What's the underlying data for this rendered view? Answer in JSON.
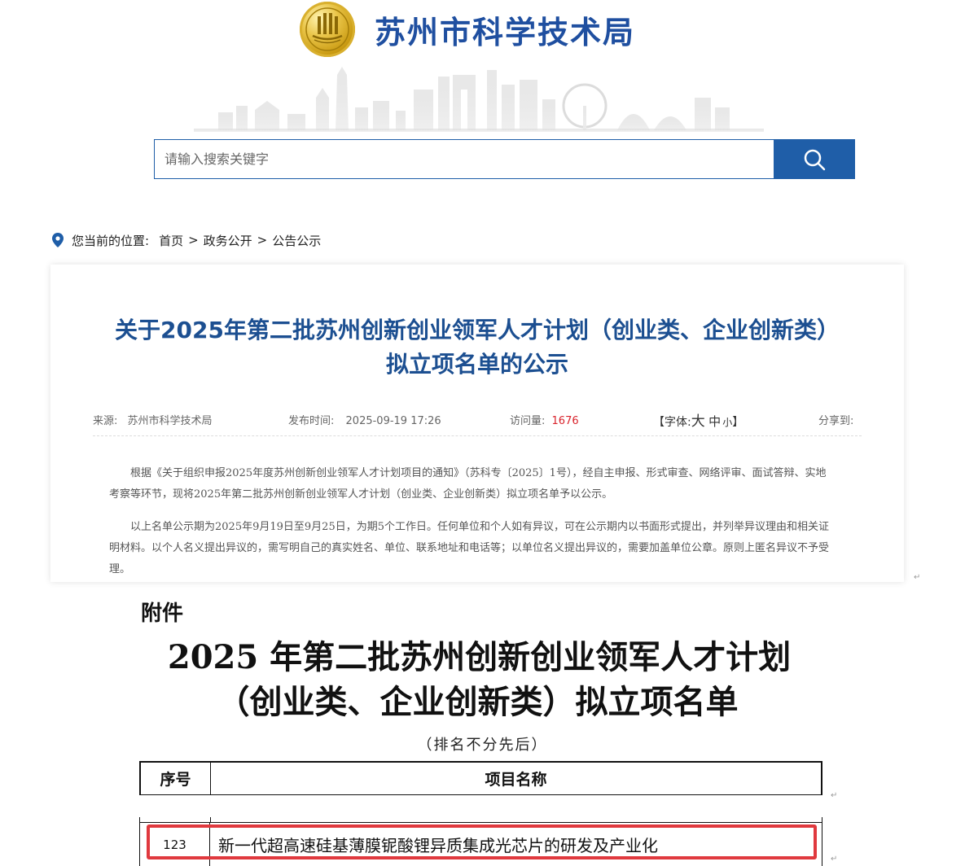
{
  "header": {
    "site_title": "苏州市科学技术局",
    "emblem_icon": "suzhou-emblem-icon"
  },
  "search": {
    "placeholder": "请输入搜索关键字",
    "button_icon": "search-icon"
  },
  "breadcrumb": {
    "prefix": "您当前的位置:",
    "items": [
      "首页",
      "政务公开",
      "公告公示"
    ],
    "separator": ">"
  },
  "article": {
    "title_line1": "关于2025年第二批苏州创新创业领军人才计划（创业类、企业创新类）",
    "title_line2": "拟立项名单的公示",
    "source_label": "来源:",
    "source_value": "苏州市科学技术局",
    "published_label": "发布时间:",
    "published_value": "2025-09-19 17:26",
    "views_label": "访问量:",
    "views_value": "1676",
    "font_label": "【字体:",
    "font_big": "大",
    "font_mid": "中",
    "font_small": "小",
    "font_close": "】",
    "share_label": "分享到:",
    "paragraph1": "根据《关于组织申报2025年度苏州创新创业领军人才计划项目的通知》（苏科专〔2025〕1号），经自主申报、形式审查、网络评审、面试答辩、实地考察等环节，现将2025年第二批苏州创新创业领军人才计划（创业类、企业创新类）拟立项名单予以公示。",
    "paragraph2": "以上名单公示期为2025年9月19日至9月25日，为期5个工作日。任何单位和个人如有异议，可在公示期内以书面形式提出，并列举异议理由和相关证明材料。以个人名义提出异议的，需写明自己的真实姓名、单位、联系地址和电话等；以单位名义提出异议的，需要加盖单位公章。原则上匿名异议不予受理。"
  },
  "attachment": {
    "label": "附件",
    "title_line1": "2025 年第二批苏州创新创业领军人才计划",
    "title_line2": "（创业类、企业创新类）拟立项名单",
    "subtitle": "（排名不分先后）",
    "columns": [
      "序号",
      "项目名称"
    ],
    "rows": [
      {
        "index": "123",
        "name": "新一代超高速硅基薄膜铌酸锂异质集成光芯片的研发及产业化"
      }
    ]
  },
  "colors": {
    "brand_blue": "#1f4fa0",
    "search_blue": "#1f5ea8",
    "title_blue": "#1c4f91",
    "views_red": "#d9232c",
    "highlight_red": "#e0393e"
  }
}
